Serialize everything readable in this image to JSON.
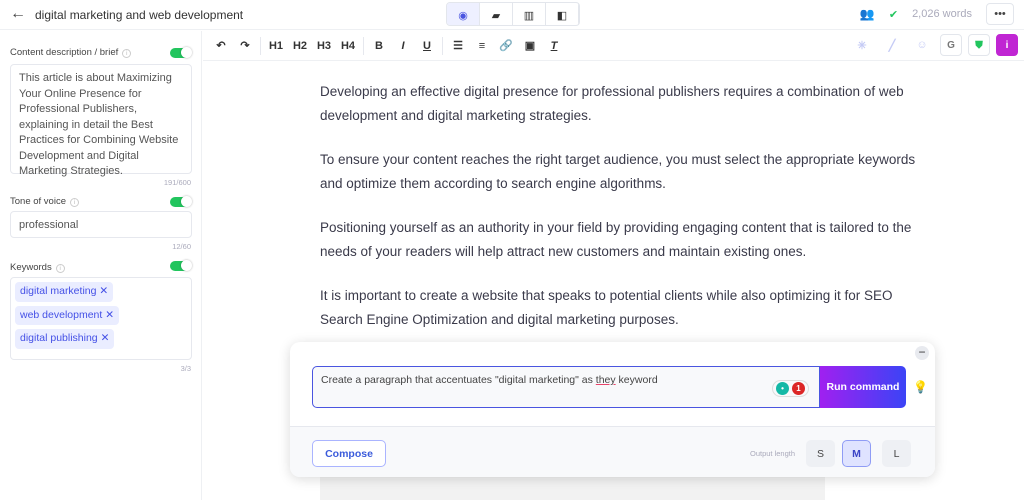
{
  "header": {
    "title": "digital marketing and web development",
    "word_count": "2,026 words",
    "views": [
      "preview",
      "comments",
      "analytics",
      "layout"
    ],
    "active_view": "preview"
  },
  "sidebar": {
    "brief": {
      "label": "Content description / brief",
      "value": "This article is about Maximizing Your Online Presence for Professional Publishers, explaining in detail the Best Practices for Combining Website Development and Digital Marketing Strategies.",
      "count": "191/600",
      "enabled": true
    },
    "tone": {
      "label": "Tone of voice",
      "value": "professional",
      "count": "12/60",
      "enabled": true
    },
    "keywords": {
      "label": "Keywords",
      "items": [
        "digital marketing",
        "web development",
        "digital publishing"
      ],
      "count": "3/3",
      "enabled": true
    }
  },
  "toolbar": {
    "h1": "H1",
    "h2": "H2",
    "h3": "H3",
    "h4": "H4",
    "bold": "B",
    "italic": "I",
    "underline": "U",
    "clear": "T"
  },
  "editor": {
    "paragraphs": [
      "Developing an effective digital presence for professional publishers requires a combination of web development and digital marketing strategies.",
      "To ensure your content reaches the right target audience, you must select the appropriate keywords and optimize them according to search engine algorithms.",
      "Positioning yourself as an authority in your field by providing engaging content that is tailored to the needs of your readers will help attract new customers and maintain existing ones.",
      "It is important to create a website that speaks to potential clients while also optimizing it for SEO Search Engine Optimization and digital marketing purposes."
    ]
  },
  "command": {
    "before": "Create a paragraph that accentuates \"digital marketing\" as ",
    "misspelled": "they",
    "after": " keyword",
    "issue_count": "1",
    "run_label": "Run command",
    "compose_label": "Compose",
    "output_length_label": "Output length",
    "sizes": [
      "S",
      "M",
      "L"
    ],
    "selected_size": "M"
  },
  "colors": {
    "accent": "#4a55e0",
    "toggle": "#22c55e",
    "run_gradient_start": "#a020f0",
    "run_gradient_end": "#3b44f6"
  }
}
